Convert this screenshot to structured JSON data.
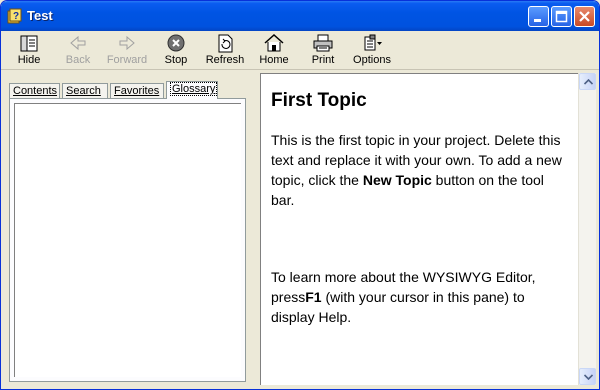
{
  "window": {
    "title": "Test",
    "icon": "help-book-icon"
  },
  "titlebar_buttons": [
    "minimize-icon",
    "maximize-icon",
    "close-icon"
  ],
  "toolbar": {
    "hide": "Hide",
    "back": "Back",
    "forward": "Forward",
    "stop": "Stop",
    "refresh": "Refresh",
    "home": "Home",
    "print": "Print",
    "options": "Options"
  },
  "nav_tabs": {
    "contents": "Contents",
    "search": "Search",
    "favorites": "Favorites",
    "glossary": "Glossary",
    "active": "Glossary"
  },
  "content": {
    "title": "First Topic",
    "p1_before": "This is the first topic in your project. Delete this text and replace it with your own. To add a new topic, click the ",
    "p1_bold": "New Topic",
    "p1_after": " button on the tool bar.",
    "p2_before": "To learn more about the WYSIWYG Editor, press",
    "p2_bold": "F1",
    "p2_after": " (with your cursor in this pane) to display Help."
  },
  "colors": {
    "titlebar": "#0054e3",
    "face": "#ece9d8",
    "close": "#c94a24"
  }
}
